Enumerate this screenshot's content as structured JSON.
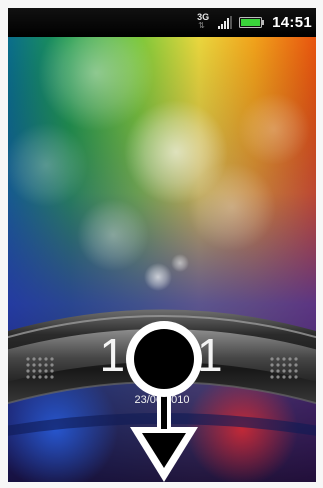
{
  "status_bar": {
    "network_type": "3G",
    "network_arrows": "⇅",
    "time": "14:51",
    "battery_color": "#3ad43a"
  },
  "lock_screen": {
    "time": "14:51",
    "date": "23/06/2010"
  },
  "icons": {
    "signal": "signal-strength-icon",
    "battery": "battery-icon",
    "unlock": "unlock-arrow-icon"
  }
}
